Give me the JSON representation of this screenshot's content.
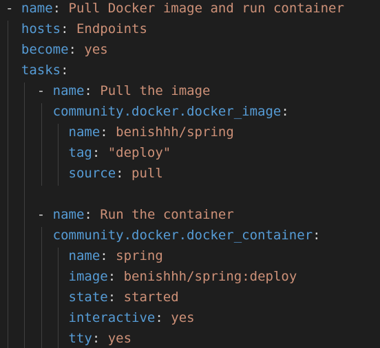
{
  "editor": {
    "language": "yaml",
    "colors": {
      "background": "#1e1e1e",
      "key": "#569cd6",
      "value": "#ce9178",
      "punctuation": "#d4d4d4",
      "indent_guide": "#404040"
    },
    "lines": [
      {
        "indent": "",
        "dash": "- ",
        "key": "name",
        "sep": ": ",
        "value": "Pull Docker image and run container"
      },
      {
        "indent": "  ",
        "dash": "",
        "key": "hosts",
        "sep": ": ",
        "value": "Endpoints"
      },
      {
        "indent": "  ",
        "dash": "",
        "key": "become",
        "sep": ": ",
        "value": "yes"
      },
      {
        "indent": "  ",
        "dash": "",
        "key": "tasks",
        "sep": ":",
        "value": ""
      },
      {
        "indent": "    ",
        "dash": "- ",
        "key": "name",
        "sep": ": ",
        "value": "Pull the image"
      },
      {
        "indent": "      ",
        "dash": "",
        "key": "community.docker.docker_image",
        "sep": ":",
        "value": ""
      },
      {
        "indent": "        ",
        "dash": "",
        "key": "name",
        "sep": ": ",
        "value": "benishhh/spring"
      },
      {
        "indent": "        ",
        "dash": "",
        "key": "tag",
        "sep": ": ",
        "value": "\"deploy\""
      },
      {
        "indent": "        ",
        "dash": "",
        "key": "source",
        "sep": ": ",
        "value": "pull"
      },
      {
        "indent": "",
        "dash": "",
        "key": "",
        "sep": "",
        "value": ""
      },
      {
        "indent": "    ",
        "dash": "- ",
        "key": "name",
        "sep": ": ",
        "value": "Run the container"
      },
      {
        "indent": "      ",
        "dash": "",
        "key": "community.docker.docker_container",
        "sep": ":",
        "value": ""
      },
      {
        "indent": "        ",
        "dash": "",
        "key": "name",
        "sep": ": ",
        "value": "spring"
      },
      {
        "indent": "        ",
        "dash": "",
        "key": "image",
        "sep": ": ",
        "value": "benishhh/spring:deploy"
      },
      {
        "indent": "        ",
        "dash": "",
        "key": "state",
        "sep": ": ",
        "value": "started"
      },
      {
        "indent": "        ",
        "dash": "",
        "key": "interactive",
        "sep": ": ",
        "value": "yes"
      },
      {
        "indent": "        ",
        "dash": "",
        "key": "tty",
        "sep": ": ",
        "value": "yes"
      }
    ]
  }
}
